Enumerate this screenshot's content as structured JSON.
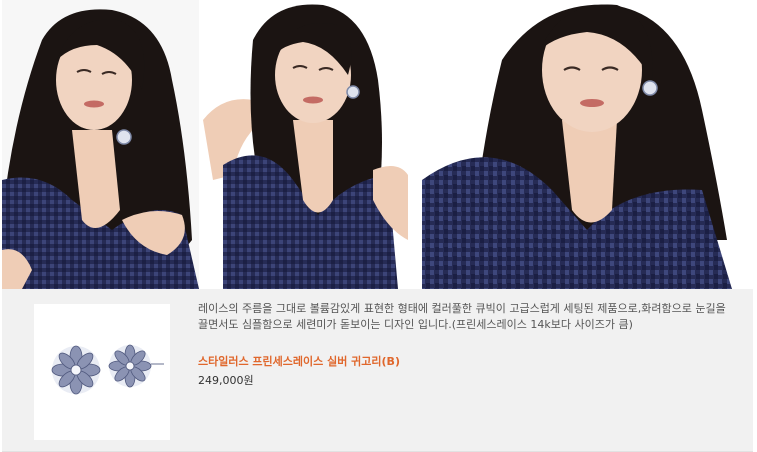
{
  "photos": [
    {
      "name": "model-photo-1"
    },
    {
      "name": "model-photo-2"
    },
    {
      "name": "model-photo-3"
    }
  ],
  "product": {
    "description_line1": "레이스의 주름을 그대로 볼륨감있게 표현한 형태에 컬러풀한 큐빅이 고급스럽게 세팅된 제품으로,화려함으로 눈길을",
    "description_line2": "끌면서도 심플함으로 세련미가 돋보이는 디자인 입니다.(프린세스레이스 14k보다 사이즈가 큼)",
    "name": "스타일러스 프린세스레이스 실버 귀고리(B)",
    "price": "249,000원"
  },
  "colors": {
    "panel_background": "#f1f1f1",
    "product_name": "#e0672c",
    "dress_sequin": "#2a2f5c",
    "hair": "#1b1412"
  }
}
